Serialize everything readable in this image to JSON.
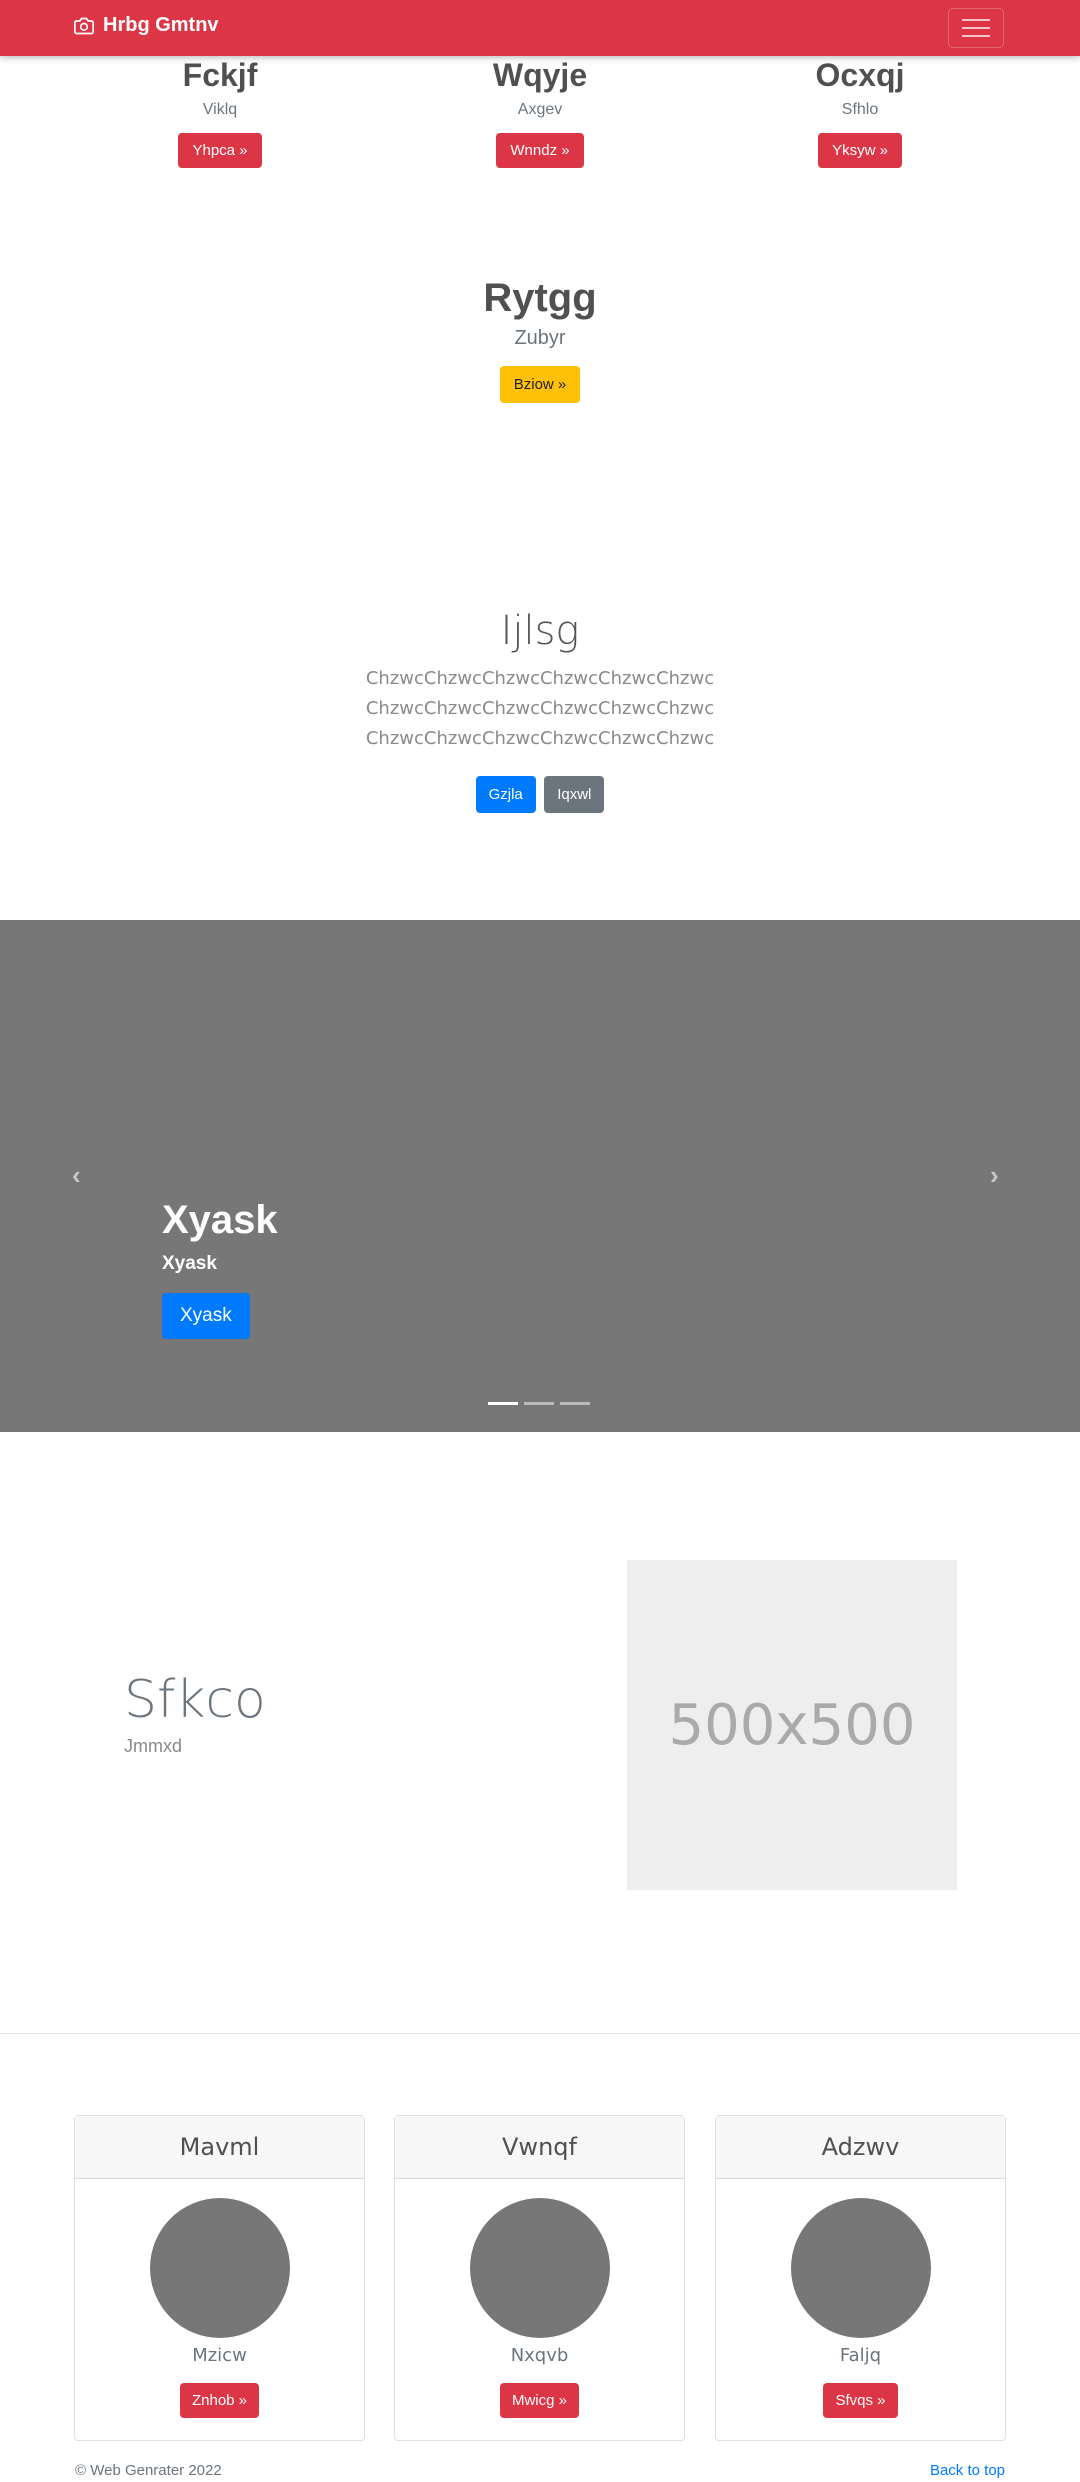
{
  "navbar": {
    "brand": "Hrbg Gmtnv"
  },
  "top_columns": [
    {
      "title": "Fckjf",
      "subtitle": "Viklq",
      "button": "Yhpca »"
    },
    {
      "title": "Wqyje",
      "subtitle": "Axgev",
      "button": "Wnndz »"
    },
    {
      "title": "Ocxqj",
      "subtitle": "Sfhlo",
      "button": "Yksyw »"
    }
  ],
  "feature": {
    "title": "Rytgg",
    "subtitle": "Zubyr",
    "button": "Bziow »"
  },
  "jumbotron": {
    "title": "Ijlsg",
    "lines": [
      "ChzwcChzwcChzwcChzwcChzwcChzwc",
      "ChzwcChzwcChzwcChzwcChzwcChzwc",
      "ChzwcChzwcChzwcChzwcChzwcChzwc"
    ],
    "primary_button": "Gzjla",
    "secondary_button": "Iqxwl"
  },
  "carousel": {
    "caption_title": "Xyask",
    "caption_text": "Xyask",
    "caption_button": "Xyask",
    "prev_icon": "‹",
    "next_icon": "›",
    "active_index": 0
  },
  "featurette": {
    "title": "Sfkco",
    "subtitle": "Jmmxd",
    "placeholder_label": "500x500"
  },
  "cards": [
    {
      "header": "Mavml",
      "name": "Mzicw",
      "button": "Znhob »"
    },
    {
      "header": "Vwnqf",
      "name": "Nxqvb",
      "button": "Mwicg »"
    },
    {
      "header": "Adzwv",
      "name": "Faljq",
      "button": "Sfvqs »"
    }
  ],
  "footer": {
    "copyright": "© Web Genrater 2022",
    "back_to_top": "Back to top"
  },
  "colors": {
    "brand": "#dc3545",
    "primary": "#007bff",
    "warning": "#ffc107",
    "secondary": "#6c757d"
  }
}
